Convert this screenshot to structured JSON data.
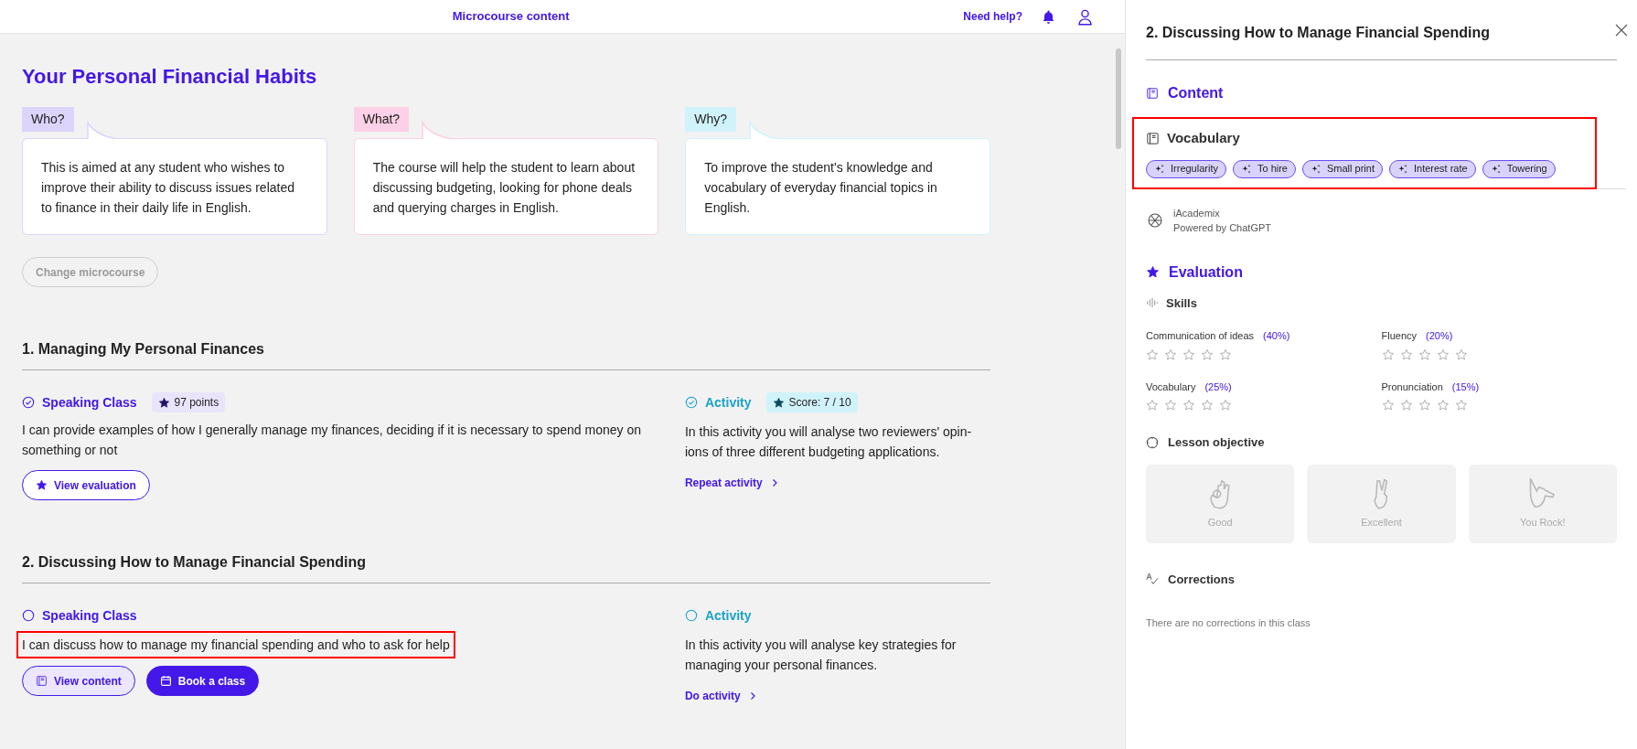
{
  "header": {
    "title": "Microcourse content",
    "help_link": "Need help?"
  },
  "course": {
    "title": "Your Personal Financial Habits",
    "cards": [
      {
        "tag": "Who?",
        "color": "#ddd4fb",
        "text": "This is aimed at any student who wishes to improve their ability to discuss issues related to finance in their daily life in English."
      },
      {
        "tag": "What?",
        "color": "#fcd0e6",
        "text": "The course will help the student to learn about discussing budgeting, looking for phone deals and querying charges in English."
      },
      {
        "tag": "Why?",
        "color": "#d0f3fb",
        "text": "To improve the student's knowledge and vocabulary of everyday financial topics in English."
      }
    ],
    "change_button": {
      "label": "Change microcourse",
      "disabled": true
    }
  },
  "lessons": [
    {
      "title": "1. Managing My Personal Finances",
      "speaking": {
        "label": "Speaking Class",
        "done": true,
        "badge": "97 points",
        "objective": "I can provide examples of how I generally manage my finances, deciding if it is necessary to spend money on something or not",
        "highlighted": false,
        "buttons": [
          {
            "kind": "outline",
            "label": "View evaluation"
          }
        ]
      },
      "activity": {
        "label": "Activity",
        "done": true,
        "badge": "Score: 7 / 10",
        "text": "In this activity you will analyse two reviewers' opin-ions of three different budgeting applications.",
        "link": "Repeat activity"
      }
    },
    {
      "title": "2. Discussing How to Manage Financial Spending",
      "speaking": {
        "label": "Speaking Class",
        "done": false,
        "objective": "I can discuss how to manage my financial spending and who to ask for help",
        "highlighted": true,
        "buttons": [
          {
            "kind": "soft",
            "label": "View content"
          },
          {
            "kind": "solid",
            "label": "Book a class"
          }
        ]
      },
      "activity": {
        "label": "Activity",
        "done": false,
        "text": "In this activity you will analyse key strategies for managing your personal finances.",
        "link": "Do activity"
      }
    }
  ],
  "panel": {
    "title": "2. Discussing How to Manage Financial Spending",
    "content_heading": "Content",
    "vocabulary": {
      "heading": "Vocabulary",
      "highlighted": true,
      "words": [
        "Irregularity",
        "To hire",
        "Small print",
        "Interest rate",
        "Towering"
      ]
    },
    "ai": {
      "name": "iAcademix",
      "powered": "Powered by ChatGPT"
    },
    "evaluation_heading": "Evaluation",
    "skills_heading": "Skills",
    "skills": [
      {
        "name": "Communication of ideas",
        "weight": "(40%)",
        "stars": 0
      },
      {
        "name": "Fluency",
        "weight": "(20%)",
        "stars": 0
      },
      {
        "name": "Vocabulary",
        "weight": "(25%)",
        "stars": 0
      },
      {
        "name": "Pronunciation",
        "weight": "(15%)",
        "stars": 0
      }
    ],
    "objective_heading": "Lesson objective",
    "objective_options": [
      {
        "kind": "ok",
        "label": "Good",
        "selected": false
      },
      {
        "kind": "peace",
        "label": "Excellent",
        "selected": false
      },
      {
        "kind": "shaka",
        "label": "You Rock!",
        "selected": false
      }
    ],
    "corrections_heading": "Corrections",
    "corrections_empty": "There are no corrections in this class"
  }
}
